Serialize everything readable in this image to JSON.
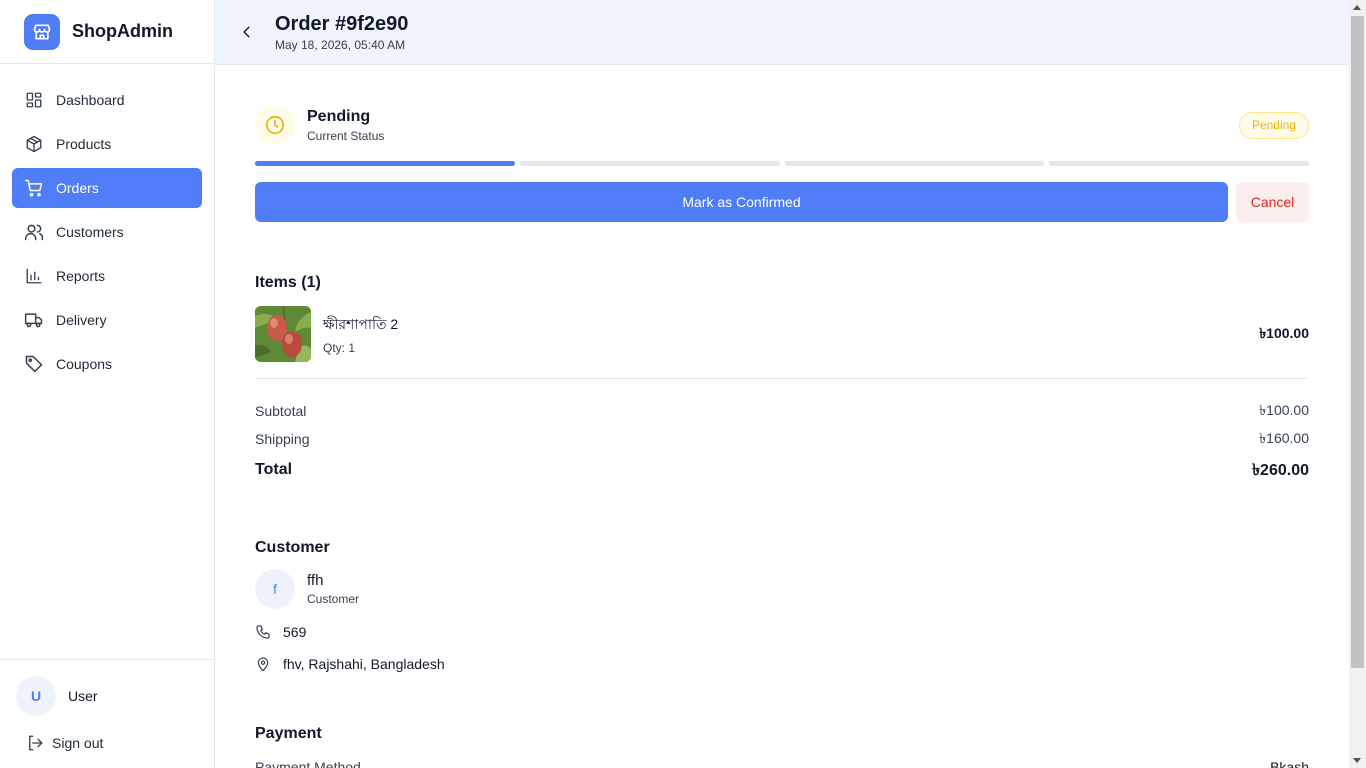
{
  "brand": {
    "name": "ShopAdmin",
    "logo_icon": "store-icon",
    "accent": "#4f7cf7"
  },
  "sidebar": {
    "items": [
      {
        "label": "Dashboard",
        "icon": "grid-icon",
        "active": false
      },
      {
        "label": "Products",
        "icon": "box-icon",
        "active": false
      },
      {
        "label": "Orders",
        "icon": "cart-icon",
        "active": true
      },
      {
        "label": "Customers",
        "icon": "users-icon",
        "active": false
      },
      {
        "label": "Reports",
        "icon": "bar-chart-icon",
        "active": false
      },
      {
        "label": "Delivery",
        "icon": "truck-icon",
        "active": false
      },
      {
        "label": "Coupons",
        "icon": "tag-icon",
        "active": false
      }
    ],
    "user": {
      "initial": "U",
      "name": "User"
    },
    "signout_label": "Sign out"
  },
  "header": {
    "title": "Order #9f2e90",
    "date": "May 18, 2026, 05:40 AM"
  },
  "status": {
    "title": "Pending",
    "subtitle": "Current Status",
    "badge": "Pending",
    "badge_color": "#eab308",
    "progress_steps_total": 4,
    "progress_steps_done": 1
  },
  "actions": {
    "confirm_label": "Mark as Confirmed",
    "cancel_label": "Cancel"
  },
  "items": {
    "title": "Items (1)",
    "list": [
      {
        "name": "ক্ষীরশাপাতি 2",
        "qty": "Qty: 1",
        "price": "৳100.00"
      }
    ]
  },
  "totals": {
    "subtotal_label": "Subtotal",
    "subtotal": "৳100.00",
    "shipping_label": "Shipping",
    "shipping": "৳160.00",
    "total_label": "Total",
    "total": "৳260.00"
  },
  "customer": {
    "title": "Customer",
    "initial": "f",
    "name": "ffh",
    "role": "Customer",
    "phone": "569",
    "address": "fhv, Rajshahi, Bangladesh"
  },
  "payment": {
    "title": "Payment",
    "method_label": "Payment Method",
    "method": "Bkash"
  }
}
